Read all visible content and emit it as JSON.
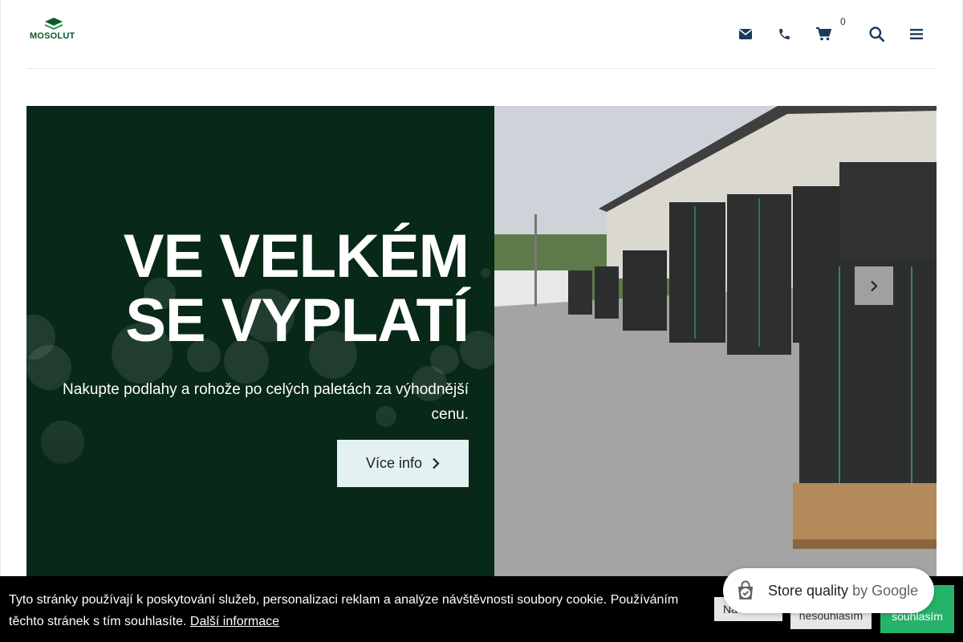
{
  "brand": {
    "logo_text": "MOSOLUT",
    "color": "#0b5a2c"
  },
  "header": {
    "icons": [
      "envelope-icon",
      "phone-icon",
      "cart-icon",
      "search-icon",
      "menu-icon"
    ],
    "cart_count": "0"
  },
  "hero": {
    "title_line1": "VE VELKÉM",
    "title_line2": "SE VYPLATÍ",
    "subtitle": "Nakupte podlahy a rohože po celých paletách za výhodnější cenu.",
    "button_label": "Více info",
    "left_bg": "#082818",
    "button_bg": "#e4f1f3"
  },
  "cookie": {
    "text": "Tyto stránky používají k poskytování služeb, personalizaci reklam a analýze návštěvnosti soubory cookie. Používáním těchto stránek s tím souhlasíte.",
    "link_label": "Další informace",
    "settings_label": "Na",
    "decline_label": "nesouhlasím",
    "accept_label": "souhlasím",
    "accept_color": "#25b36a"
  },
  "store_quality": {
    "label": "Store quality",
    "by": "by Google"
  }
}
